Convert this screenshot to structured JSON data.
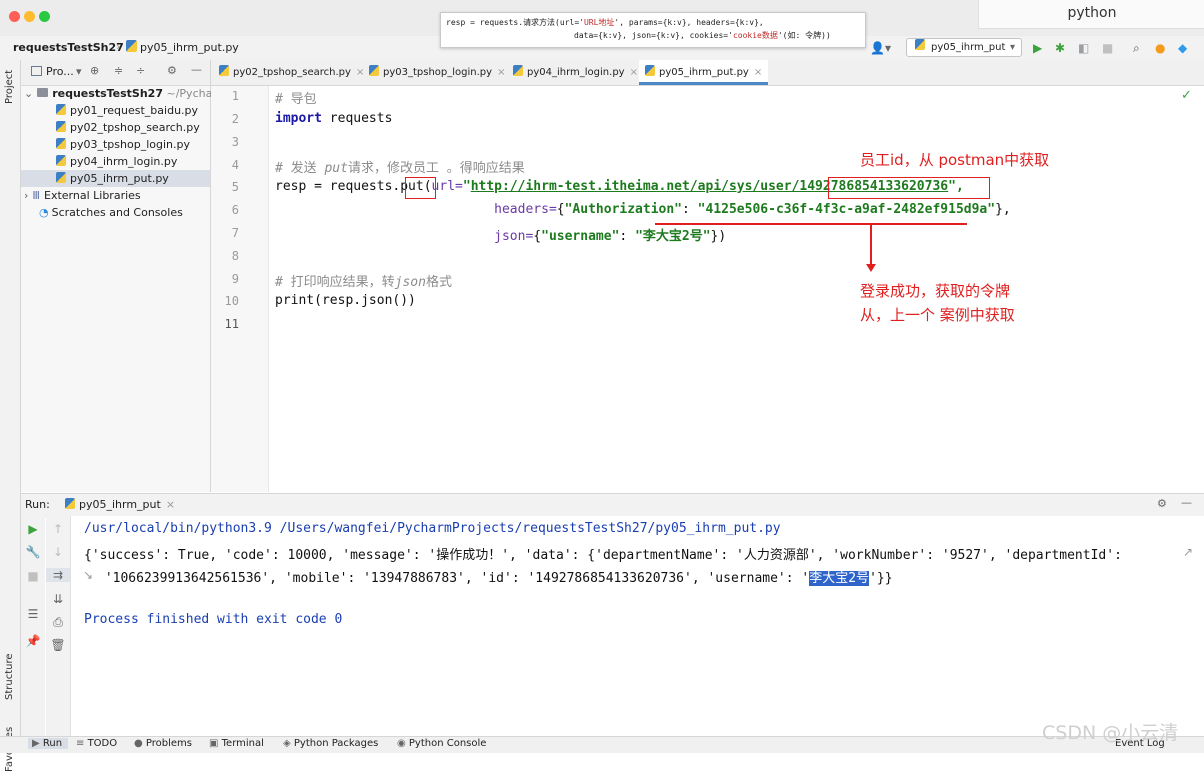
{
  "window": {
    "tooltip_line1_a": "resp = requests.请求方法(url='",
    "tooltip_line1_str": "URL地址",
    "tooltip_line1_b": "', params={k:v}, headers={k:v},",
    "tooltip_line2_a": "data={k:v}, json={k:v}, cookies='",
    "tooltip_line2_str": "cookie数据",
    "tooltip_line2_b": "'(如: 令牌))",
    "top_right_tab": "python"
  },
  "navbar": {
    "project": "requestsTestSh27",
    "file": "py05_ihrm_put.py",
    "run_config": "py05_ihrm_put"
  },
  "left_strip": {
    "project": "Project",
    "structure": "Structure",
    "favorites": "Favorites"
  },
  "project_panel": {
    "header": "Pro...",
    "root": "requestsTestSh27",
    "root_path": "~/Pychar",
    "files": [
      "py01_request_baidu.py",
      "py02_tpshop_search.py",
      "py03_tpshop_login.py",
      "py04_ihrm_login.py",
      "py05_ihrm_put.py"
    ],
    "external": "External Libraries",
    "scratches": "Scratches and Consoles"
  },
  "tabs": [
    "py02_tpshop_search.py",
    "py03_tpshop_login.py",
    "py04_ihrm_login.py",
    "py05_ihrm_put.py"
  ],
  "editor": {
    "line_numbers": [
      "1",
      "2",
      "3",
      "4",
      "5",
      "6",
      "7",
      "8",
      "9",
      "10",
      "11"
    ],
    "l1": "# 导包",
    "l2_kw": "import",
    "l2_rest": " requests",
    "l4_a": "# 发送 ",
    "l4_i": "put",
    "l4_b": "请求，修改员工 。得响应结果",
    "l5_a": "resp = requests.",
    "l5_put": "put",
    "l5_b": "(",
    "l5_param": "url=",
    "l5_q1": "\"",
    "l5_url": "http://ihrm-test.itheima.net/api/sys/user/1492786854133620736",
    "l5_q2": "\",",
    "l6_indent": "                            ",
    "l6_param": "headers=",
    "l6_a": "{",
    "l6_key": "\"Authorization\"",
    "l6_colon": ": ",
    "l6_val": "\"4125e506-c36f-4f3c-a9af-2482ef915d9a\"",
    "l6_end": "},",
    "l7_indent": "                            ",
    "l7_param": "json=",
    "l7_a": "{",
    "l7_key": "\"username\"",
    "l7_colon": ": ",
    "l7_val": "\"李大宝2号\"",
    "l7_end": "})",
    "l9_a": "# 打印响应结果，转",
    "l9_i": "json",
    "l9_b": "格式",
    "l10": "print(resp.json())"
  },
  "annotations": {
    "employee_id": "员工id，从 postman中获取",
    "token_line1": "登录成功，获取的令牌",
    "token_line2": "从，上一个 案例中获取"
  },
  "run_panel": {
    "label": "Run:",
    "tab": "py05_ihrm_put",
    "cmd": "/usr/local/bin/python3.9 /Users/wangfei/PycharmProjects/requestsTestSh27/py05_ihrm_put.py",
    "out1": "{'success': True, 'code': 10000, 'message': '操作成功！', 'data': {'departmentName': '人力资源部', 'workNumber': '9527', 'departmentId':",
    "out2_a": " '1066239913642561536', 'mobile': '13947886783', 'id': '1492786854133620736', 'username': '",
    "out2_sel": "李大宝2号",
    "out2_b": "'}}",
    "finished": "Process finished with exit code 0"
  },
  "bottom_bar": {
    "run": "Run",
    "todo": "TODO",
    "problems": "Problems",
    "terminal": "Terminal",
    "packages": "Python Packages",
    "console": "Python Console",
    "event_log": "Event Log"
  },
  "watermark": "CSDN @小云清"
}
